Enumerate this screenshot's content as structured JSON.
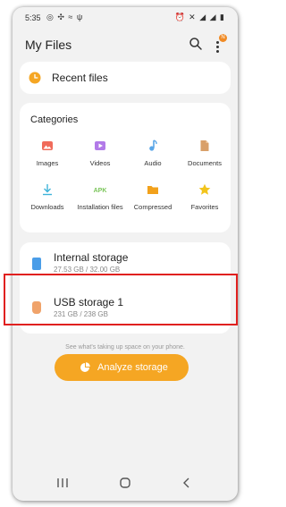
{
  "status_bar": {
    "time": "5:35"
  },
  "header": {
    "title": "My Files",
    "notification_count": "N"
  },
  "recent": {
    "label": "Recent files",
    "icon": "clock-icon",
    "color": "#f5a623"
  },
  "categories": {
    "title": "Categories",
    "items": [
      {
        "label": "Images",
        "icon": "image-icon",
        "color": "#f06b5a"
      },
      {
        "label": "Videos",
        "icon": "video-icon",
        "color": "#b27ae8"
      },
      {
        "label": "Audio",
        "icon": "music-icon",
        "color": "#5aa6e8"
      },
      {
        "label": "Documents",
        "icon": "document-icon",
        "color": "#d9a06a"
      },
      {
        "label": "Downloads",
        "icon": "download-icon",
        "color": "#3fb3d9"
      },
      {
        "label": "Installation files",
        "icon_text": "APK",
        "color": "#7ac55a"
      },
      {
        "label": "Compressed",
        "icon": "folder-icon",
        "color": "#f2a11c"
      },
      {
        "label": "Favorites",
        "icon": "star-icon",
        "color": "#f2c41c"
      }
    ]
  },
  "storage": {
    "items": [
      {
        "name": "Internal storage",
        "size": "27.53 GB / 32.00 GB",
        "icon": "phone-storage-icon",
        "color": "#4a9de8"
      },
      {
        "name": "USB storage 1",
        "size": "231 GB / 238 GB",
        "icon": "usb-icon",
        "color": "#f0a36a"
      }
    ]
  },
  "analyze": {
    "hint": "See what's taking up space on your phone.",
    "button_label": "Analyze storage",
    "color": "#f5a623"
  },
  "highlight_color": "#e0201f"
}
